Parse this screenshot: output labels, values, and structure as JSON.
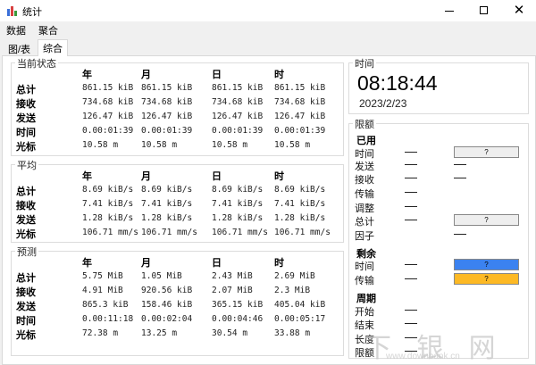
{
  "window": {
    "title": "统计",
    "icon": "bar-chart-icon",
    "controls": [
      "minimize-icon",
      "maximize-icon",
      "close-icon"
    ]
  },
  "menu": [
    "数据",
    "聚合"
  ],
  "tabs": [
    {
      "label": "图/表",
      "active": false
    },
    {
      "label": "综合",
      "active": true
    }
  ],
  "columns": [
    "年",
    "月",
    "日",
    "时"
  ],
  "current": {
    "title": "当前状态",
    "rows": [
      {
        "label": "总计",
        "values": [
          "861.15 kiB",
          "861.15 kiB",
          "861.15 kiB",
          "861.15 kiB"
        ]
      },
      {
        "label": "接收",
        "values": [
          "734.68 kiB",
          "734.68 kiB",
          "734.68 kiB",
          "734.68 kiB"
        ]
      },
      {
        "label": "发送",
        "values": [
          "126.47 kiB",
          "126.47 kiB",
          "126.47 kiB",
          "126.47 kiB"
        ]
      },
      {
        "label": "时间",
        "values": [
          "0.00:01:39",
          "0.00:01:39",
          "0.00:01:39",
          "0.00:01:39"
        ]
      },
      {
        "label": "光标",
        "values": [
          "10.58 m",
          "10.58 m",
          "10.58 m",
          "10.58 m"
        ]
      }
    ]
  },
  "average": {
    "title": "平均",
    "rows": [
      {
        "label": "总计",
        "values": [
          "8.69 kiB/s",
          "8.69 kiB/s",
          "8.69 kiB/s",
          "8.69 kiB/s"
        ]
      },
      {
        "label": "接收",
        "values": [
          "7.41 kiB/s",
          "7.41 kiB/s",
          "7.41 kiB/s",
          "7.41 kiB/s"
        ]
      },
      {
        "label": "发送",
        "values": [
          "1.28 kiB/s",
          "1.28 kiB/s",
          "1.28 kiB/s",
          "1.28 kiB/s"
        ]
      },
      {
        "label": "光标",
        "values": [
          "106.71 mm/s",
          "106.71 mm/s",
          "106.71 mm/s",
          "106.71 mm/s"
        ]
      }
    ]
  },
  "forecast": {
    "title": "预测",
    "rows": [
      {
        "label": "总计",
        "values": [
          "5.75 MiB",
          "1.05 MiB",
          "2.43 MiB",
          "2.69 MiB"
        ]
      },
      {
        "label": "接收",
        "values": [
          "4.91 MiB",
          "920.56 kiB",
          "2.07 MiB",
          "2.3 MiB"
        ]
      },
      {
        "label": "发送",
        "values": [
          "865.3 kiB",
          "158.46 kiB",
          "365.15 kiB",
          "405.04 kiB"
        ]
      },
      {
        "label": "时间",
        "values": [
          "0.00:11:18",
          "0.00:02:04",
          "0.00:04:46",
          "0.00:05:17"
        ]
      },
      {
        "label": "光标",
        "values": [
          "72.38 m",
          "13.25 m",
          "30.54 m",
          "33.88 m"
        ]
      }
    ]
  },
  "clock": {
    "title": "时间",
    "time": "08:18:44",
    "date": "2023/2/23"
  },
  "quota": {
    "title": "限额",
    "items": [
      {
        "label": "已用",
        "header": true
      },
      {
        "label": "时间",
        "dash1": true,
        "button": "?",
        "button_color": "#eeeeee"
      },
      {
        "label": "发送",
        "dash1": true,
        "dash2": true
      },
      {
        "label": "接收",
        "dash1": true,
        "dash2": true
      },
      {
        "label": "传输",
        "dash1": true
      },
      {
        "label": "调整",
        "dash1": true
      },
      {
        "label": "总计",
        "dash1": true,
        "button": "?",
        "button_color": "#eeeeee"
      },
      {
        "label": "因子",
        "dash2": true
      },
      {
        "label": "剩余",
        "header": true
      },
      {
        "label": "时间",
        "dash1": true,
        "button": "?",
        "button_color": "#3b82f0"
      },
      {
        "label": "传输",
        "dash1": true,
        "button": "?",
        "button_color": "#fdb924"
      },
      {
        "label": "周期",
        "header": true
      },
      {
        "label": "开始",
        "dash1": true
      },
      {
        "label": "结束",
        "dash1": true
      },
      {
        "label": "长度",
        "dash1": true
      },
      {
        "label": "限额",
        "dash1": true
      }
    ]
  },
  "watermark": {
    "text": "下 银 网",
    "url": "www.downbank.cn"
  }
}
